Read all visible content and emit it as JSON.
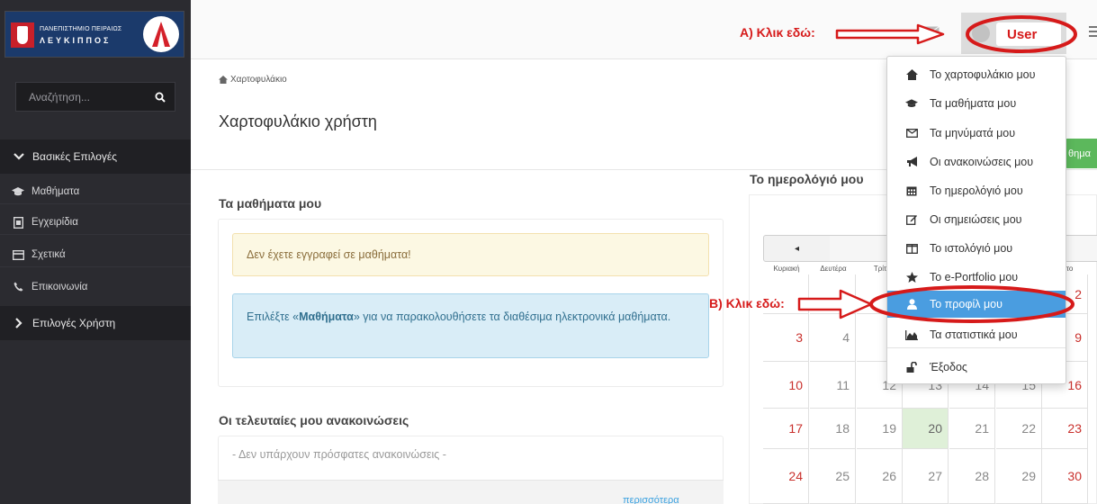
{
  "colors": {
    "sidebar_bg": "#2b2b30",
    "annotation_red": "#d61a1a",
    "active_blue": "#4a9de0",
    "success_green": "#5cb85c",
    "weekend_red": "#c9302c"
  },
  "logo": {
    "line1": "ΠΑΝΕΠΙΣΤΗΜΙΟ ΠΕΙΡΑΙΩΣ",
    "line2": "ΛΕΥΚΙΠΠΟΣ"
  },
  "sidebar": {
    "search_placeholder": "Αναζήτηση...",
    "section1": "Βασικές Επιλογές",
    "items": [
      {
        "label": "Μαθήματα",
        "icon": "graduation-cap-icon"
      },
      {
        "label": "Εγχειρίδια",
        "icon": "file-icon"
      },
      {
        "label": "Σχετικά",
        "icon": "card-icon"
      },
      {
        "label": "Επικοινωνία",
        "icon": "phone-icon"
      }
    ],
    "section2": "Επιλογές Χρήστη"
  },
  "topbar": {
    "annotation_a": "A) Κλικ εδώ:",
    "user_label": "User"
  },
  "main": {
    "breadcrumb": "Χαρτοφυλάκιο",
    "title": "Χαρτοφυλάκιο χρήστη",
    "green_button": "θημα",
    "courses_title": "Τα μαθήματα μου",
    "warning": "Δεν έχετε εγγραφεί σε μαθήματα!",
    "info_prefix": "Επιλέξτε «",
    "info_bold": "Μαθήματα",
    "info_suffix": "» για να παρακολουθήσετε τα διαθέσιμα ηλεκτρονικά μαθήματα.",
    "announcements_title": "Οι τελευταίες μου ανακοινώσεις",
    "announcements_empty": "- Δεν υπάρχουν πρόσφατες ανακοινώσεις -",
    "more_link": "περισσότερα"
  },
  "calendar": {
    "title": "Το ημερολόγιό μου",
    "prev": "◂",
    "days": [
      "Κυριακή",
      "Δευτέρα",
      "Τρίτ",
      "",
      "",
      "",
      "βατο"
    ],
    "rows": [
      [
        "",
        "",
        "",
        "",
        "",
        "",
        "2"
      ],
      [
        "3",
        "4",
        "",
        "",
        "",
        "",
        "9"
      ],
      [
        "10",
        "11",
        "12",
        "13",
        "14",
        "15",
        "16"
      ],
      [
        "17",
        "18",
        "19",
        "20",
        "21",
        "22",
        "23"
      ],
      [
        "24",
        "25",
        "26",
        "27",
        "28",
        "29",
        "30"
      ]
    ],
    "today": "20"
  },
  "dropdown": {
    "annotation_b": "B) Κλικ εδώ:",
    "items": [
      {
        "label": "Το χαρτοφυλάκιο μου",
        "icon": "home-icon"
      },
      {
        "label": "Τα μαθήματα μου",
        "icon": "graduation-cap-icon"
      },
      {
        "label": "Τα μηνύματά μου",
        "icon": "envelope-icon"
      },
      {
        "label": "Οι ανακοινώσεις μου",
        "icon": "bullhorn-icon"
      },
      {
        "label": "Το ημερολόγιό μου",
        "icon": "calendar-icon"
      },
      {
        "label": "Οι σημειώσεις μου",
        "icon": "edit-icon"
      },
      {
        "label": "Το ιστολόγιό μου",
        "icon": "columns-icon"
      },
      {
        "label": "Το e-Portfolio μου",
        "icon": "star-icon"
      },
      {
        "label": "Το προφίλ μου",
        "icon": "user-icon"
      },
      {
        "label": "Τα στατιστικά μου",
        "icon": "area-chart-icon"
      },
      {
        "label": "Έξοδος",
        "icon": "unlock-icon"
      }
    ],
    "active_index": 8
  }
}
